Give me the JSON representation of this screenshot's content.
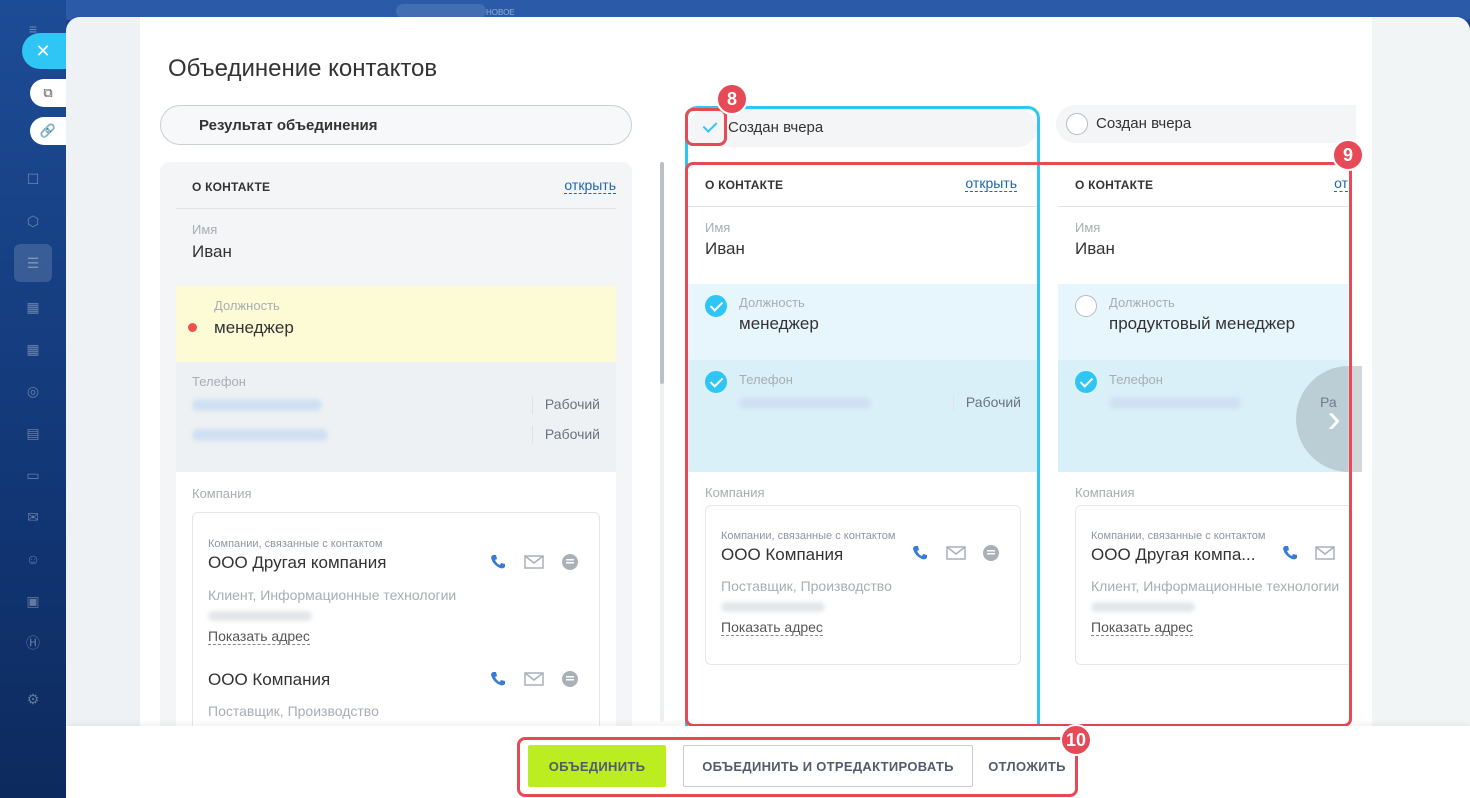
{
  "background": {
    "top_label": "НОВОЕ"
  },
  "page": {
    "title": "Объединение контактов"
  },
  "result": {
    "header": "Результат объединения",
    "section_title": "О КОНТАКТЕ",
    "open_link": "открыть",
    "name_label": "Имя",
    "name_value": "Иван",
    "position_label": "Должность",
    "position_value": "менеджер",
    "phone_label": "Телефон",
    "phones": [
      {
        "type": "Рабочий"
      },
      {
        "type": "Рабочий"
      }
    ],
    "company_label": "Компания",
    "companies_caption": "Компании, связанные с контактом",
    "companies": [
      {
        "name": "ООО Другая компания",
        "details": "Клиент, Информационные технологии",
        "address_link": "Показать адрес"
      },
      {
        "name": "ООО Компания",
        "details": "Поставщик, Производство"
      }
    ]
  },
  "candidates": [
    {
      "header": "Создан вчера",
      "selected": true,
      "section_title": "О КОНТАКТЕ",
      "open_link": "открыть",
      "name_label": "Имя",
      "name_value": "Иван",
      "position_label": "Должность",
      "position_value": "менеджер",
      "phone_label": "Телефон",
      "phone_type": "Рабочий",
      "company_label": "Компания",
      "companies_caption": "Компании, связанные с контактом",
      "company_name": "ООО Компания",
      "company_details": "Поставщик, Производство",
      "address_link": "Показать адрес"
    },
    {
      "header": "Создан вчера",
      "selected": false,
      "section_title": "О КОНТАКТЕ",
      "open_link": "от",
      "name_label": "Имя",
      "name_value": "Иван",
      "position_label": "Должность",
      "position_value": "продуктовый менеджер",
      "phone_label": "Телефон",
      "phone_type": "Ра",
      "company_label": "Компания",
      "companies_caption": "Компании, связанные с контактом",
      "company_name": "ООО Другая компа...",
      "company_details": "Клиент, Информационные технологии",
      "address_link": "Показать адрес"
    }
  ],
  "annotations": [
    "8",
    "9",
    "10"
  ],
  "buttons": {
    "merge": "ОБЪЕДИНИТЬ",
    "merge_edit": "ОБЪЕДИНИТЬ И ОТРЕДАКТИРОВАТЬ",
    "later": "ОТЛОЖИТЬ"
  },
  "colors": {
    "accent": "#2fc6f6",
    "annotation": "#e64a57",
    "merge_button": "#bbed21",
    "highlight_yellow": "#fdfbd6",
    "required_dot": "#f0504c"
  }
}
